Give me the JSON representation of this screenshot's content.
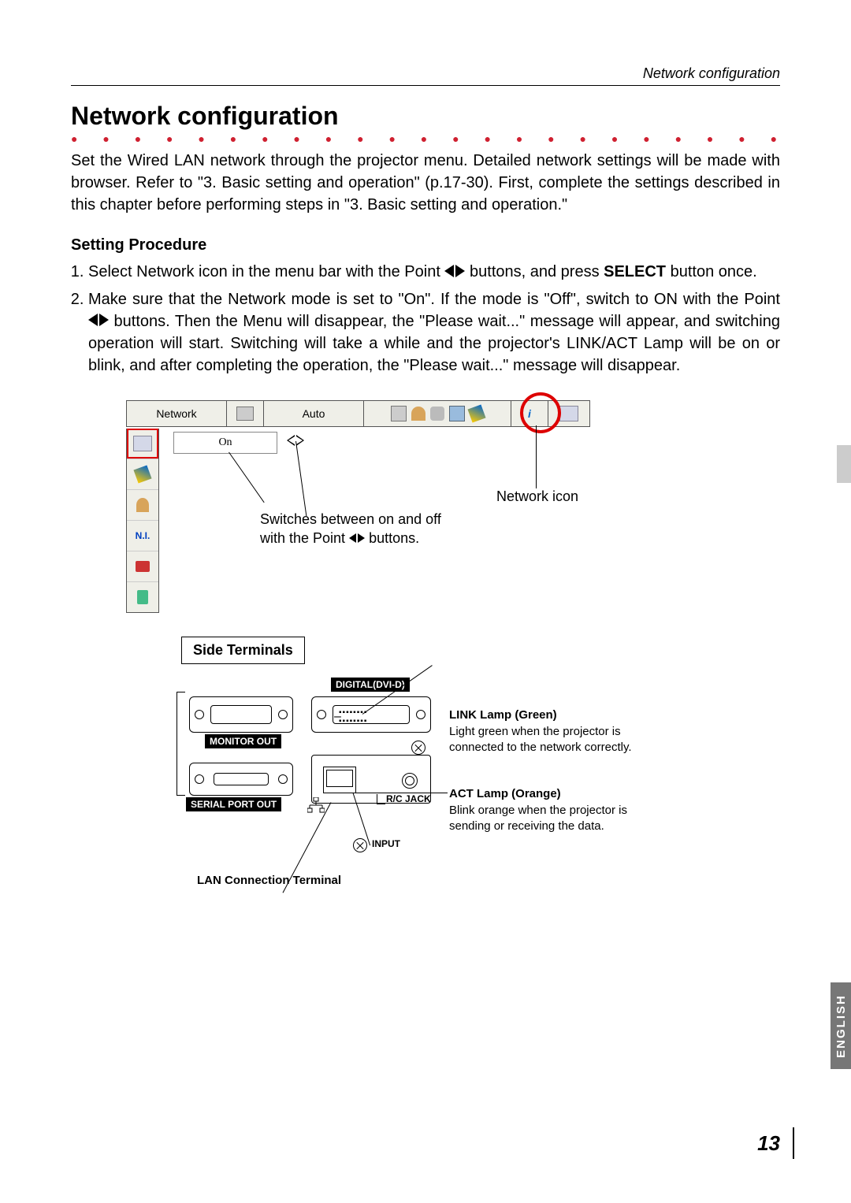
{
  "header": {
    "running_head": "Network configuration"
  },
  "title": "Network configuration",
  "intro": "Set the Wired LAN network through the projector menu. Detailed network settings will be made with browser. Refer to \"3. Basic setting and operation\" (p.17-30). First, complete the settings described in this chapter before performing steps in \"3. Basic setting and operation.\"",
  "subheading": "Setting Procedure",
  "steps": {
    "s1a": "Select Network icon in the menu bar with the Point ",
    "s1b": " buttons, and press ",
    "s1_bold": "SELECT",
    "s1c": " button once.",
    "s2a": "Make sure that the Network mode is set to \"On\". If the mode is \"Off\", switch to ON with the Point ",
    "s2b": " buttons. Then the Menu will disappear, the \"Please wait...\" message will appear, and switching operation will start. Switching will take a while and the projector's LINK/ACT Lamp will be on or blink, and after completing the operation, the \"Please wait...\" message will disappear."
  },
  "menu": {
    "title": "Network",
    "mode_label": "Auto",
    "on_label": "On",
    "nl_label": "N.I.",
    "network_icon_label": "Network icon",
    "switch_note_a": "Switches between on and off",
    "switch_note_b": "with the Point ",
    "switch_note_c": " buttons."
  },
  "terminals": {
    "box_title": "Side Terminals",
    "digital": "DIGITAL(DVI-D)",
    "monitor_out": "MONITOR OUT",
    "serial_out": "SERIAL PORT OUT",
    "rc_jack": "R/C JACK",
    "input": "INPUT",
    "lan_terminal": "LAN Connection Terminal",
    "link_head": "LINK Lamp (Green)",
    "link_body": "Light green when the projector is connected to the network correctly.",
    "act_head": "ACT Lamp (Orange)",
    "act_body": "Blink orange when the projector is sending or receiving the data."
  },
  "side": {
    "language": "ENGLISH"
  },
  "page_number": "13"
}
